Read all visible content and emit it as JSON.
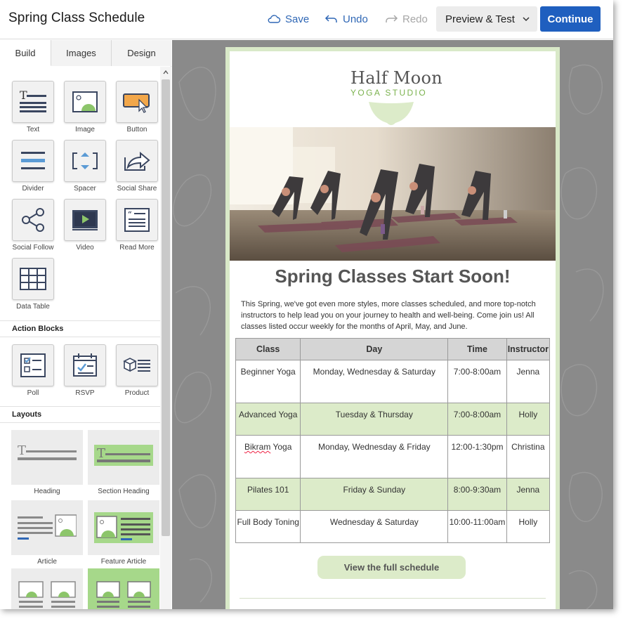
{
  "header": {
    "title": "Spring Class Schedule",
    "save": "Save",
    "undo": "Undo",
    "redo": "Redo",
    "preview": "Preview & Test",
    "continue": "Continue"
  },
  "panel": {
    "tabs": [
      "Build",
      "Images",
      "Design"
    ],
    "blocks": [
      {
        "label": "Text",
        "icon": "text-block-icon"
      },
      {
        "label": "Image",
        "icon": "image-block-icon"
      },
      {
        "label": "Button",
        "icon": "button-block-icon"
      },
      {
        "label": "Divider",
        "icon": "divider-block-icon"
      },
      {
        "label": "Spacer",
        "icon": "spacer-block-icon"
      },
      {
        "label": "Social Share",
        "icon": "social-share-icon"
      },
      {
        "label": "Social Follow",
        "icon": "social-follow-icon"
      },
      {
        "label": "Video",
        "icon": "video-block-icon"
      },
      {
        "label": "Read More",
        "icon": "read-more-icon"
      },
      {
        "label": "Data Table",
        "icon": "data-table-icon"
      }
    ],
    "action_blocks_title": "Action Blocks",
    "action_blocks": [
      {
        "label": "Poll",
        "icon": "poll-icon"
      },
      {
        "label": "RSVP",
        "icon": "rsvp-icon"
      },
      {
        "label": "Product",
        "icon": "product-icon"
      }
    ],
    "layouts_title": "Layouts",
    "layouts": [
      {
        "label": "Heading"
      },
      {
        "label": "Section Heading"
      },
      {
        "label": "Article"
      },
      {
        "label": "Feature Article"
      }
    ]
  },
  "email": {
    "logo_line1": "Half Moon",
    "logo_line2": "YOGA STUDIO",
    "headline": "Spring Classes Start Soon!",
    "intro": "This Spring, we've got even more styles, more classes scheduled, and more top-notch instructors to help lead you on your journey to health and well-being. Come join us! All classes listed occur weekly for the months of April, May, and June.",
    "table": {
      "headers": [
        "Class",
        "Day",
        "Time",
        "Instructor"
      ],
      "rows": [
        [
          "Beginner Yoga",
          "Monday, Wednesday & Saturday",
          "7:00-8:00am",
          "Jenna"
        ],
        [
          "Advanced Yoga",
          "Tuesday & Thursday",
          "7:00-8:00am",
          "Holly"
        ],
        [
          "Bikram Yoga",
          "Monday, Wednesday & Friday",
          "12:00-1:30pm",
          "Christina"
        ],
        [
          "Pilates 101",
          "Friday & Sunday",
          "8:00-9:30am",
          "Jenna"
        ],
        [
          "Full Body Toning",
          "Wednesday & Saturday",
          "10:00-11:00am",
          "Holly"
        ]
      ]
    },
    "cta": "View the full schedule"
  },
  "colors": {
    "accent_blue": "#1f5fbf",
    "email_border": "#d9e9c8",
    "table_alt_row": "#dcebc9",
    "canvas_bg": "#8a8a8a"
  }
}
